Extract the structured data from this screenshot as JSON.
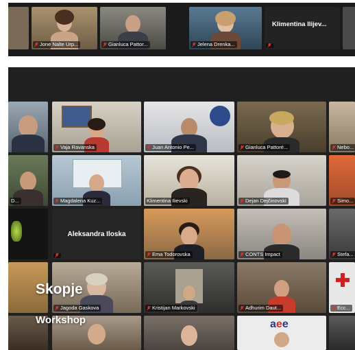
{
  "top_strip": {
    "tiles": [
      {
        "name": "Jone Nalte Urp..."
      },
      {
        "name": "Gianluca Pattor..."
      },
      {
        "name": "Jelena Drenka..."
      }
    ],
    "featured_name": "Klimentina Ilijev..."
  },
  "gallery": {
    "row1": [
      "",
      "Vaja Ravanska",
      "Juan Antonio Pe...",
      "Gianluca Pattoré...",
      "Nebo..."
    ],
    "row2": [
      "D...",
      "Magdalena Kuz...",
      "Klimentina Ilievski",
      "Dejan Dejčinovski",
      "Simo..."
    ],
    "row3": [
      "",
      "Aleksandra Iloska",
      "Ema Todorovska",
      "CONTS Impact",
      "Stefa..."
    ],
    "row4": [
      "",
      "Jagoda Gaskova",
      "Kristijan Markovski",
      "Adhurim Daut...",
      "Ecc..."
    ],
    "row5": [
      "",
      "",
      "",
      "",
      ""
    ]
  },
  "overlay": {
    "title": "Skopje",
    "subtitle": "Workshop"
  },
  "colors": {
    "active_speaker": "#e8e24a",
    "mic_muted": "#e03030"
  }
}
